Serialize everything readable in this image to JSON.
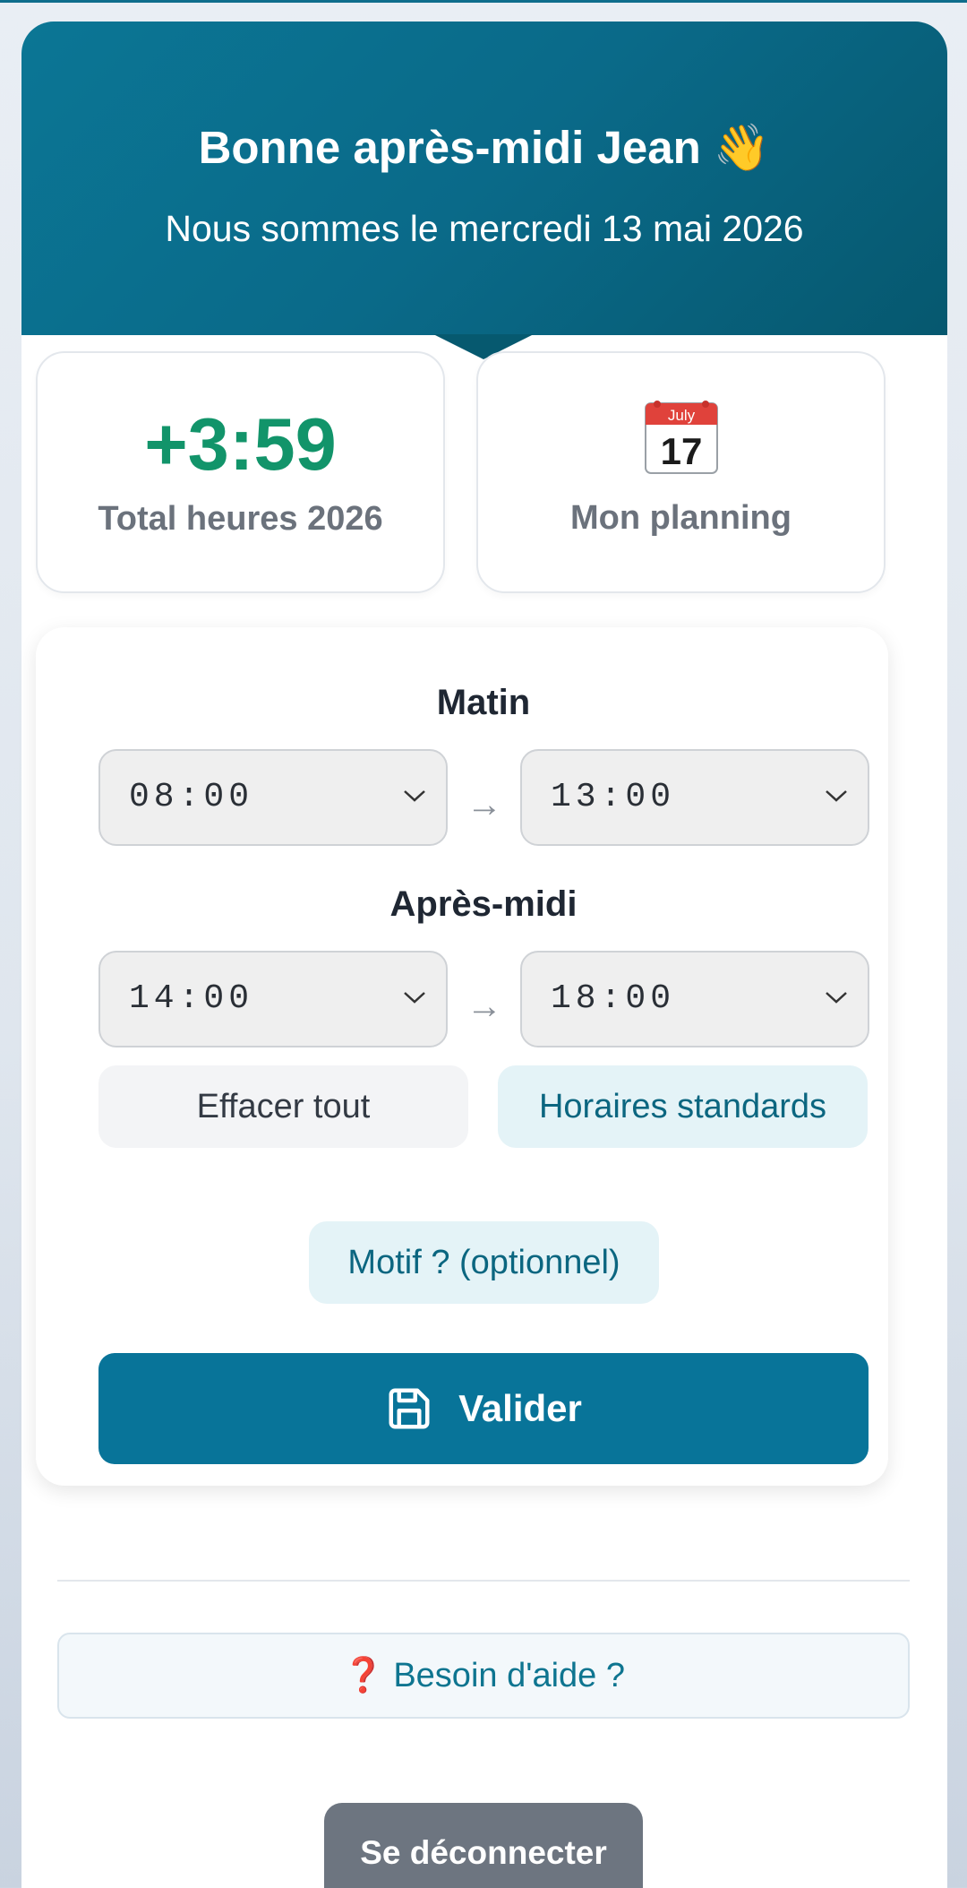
{
  "header": {
    "greeting": "Bonne après-midi Jean 👋",
    "date_line": "Nous sommes le mercredi 13 mai 2026"
  },
  "stats": {
    "total_hours_value": "+3:59",
    "total_hours_label": "Total heures 2026",
    "planning_icon": "calendar-icon",
    "calendar_month": "July",
    "calendar_day": "17",
    "planning_label": "Mon planning"
  },
  "schedule": {
    "morning": {
      "title": "Matin",
      "start": "08:00",
      "end": "13:00"
    },
    "afternoon": {
      "title": "Après-midi",
      "start": "14:00",
      "end": "18:00"
    },
    "arrow": "→"
  },
  "actions": {
    "clear_label": "Effacer tout",
    "standard_label": "Horaires standards",
    "motif_label": "Motif ? (optionnel)",
    "validate_label": "Valider",
    "validate_icon": "save-icon"
  },
  "footer": {
    "help_icon": "❓",
    "help_label": "Besoin d'aide ?",
    "logout_label": "Se déconnecter"
  },
  "colors": {
    "primary": "#087499",
    "positive": "#12946a",
    "help_icon": "#d9423a"
  }
}
